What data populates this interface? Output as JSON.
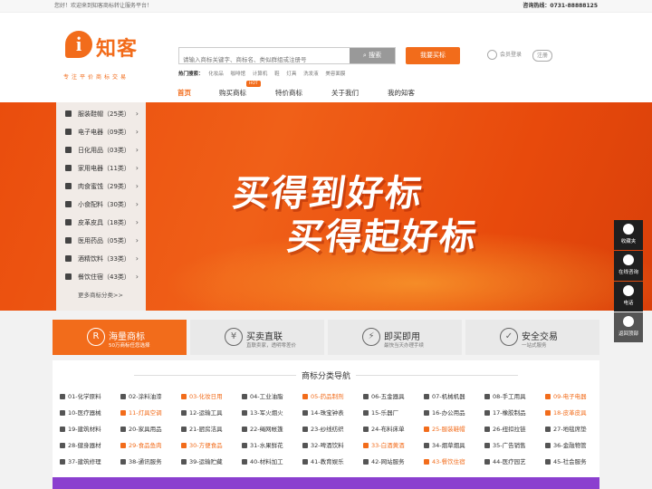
{
  "topbar": {
    "welcome": "您好！欢迎来到知客商标转让服务平台！",
    "hotline": "咨询热线：0731-88888125"
  },
  "logo": {
    "mark": "i",
    "name": "知客",
    "slogan": "专注平价商标交易"
  },
  "search": {
    "placeholder": "请输入商标关键字、商标名、类似群组或注册号",
    "button": "搜索",
    "hot_label": "热门搜索：",
    "hot_terms": [
      "化妆品",
      "咖啡馆",
      "计算机",
      "鞋",
      "灯具",
      "洗发液",
      "美容面膜"
    ]
  },
  "header": {
    "buy_button": "我要买标",
    "login": "会员登录",
    "register": "注册"
  },
  "nav": {
    "items": [
      "首页",
      "购买商标",
      "特价商标",
      "关于我们",
      "我的知客"
    ],
    "hot_badge": "HOT"
  },
  "banner": {
    "line1": "买得到好标",
    "line2": "买得起好标"
  },
  "categories": [
    {
      "label": "服装鞋帽（25类）"
    },
    {
      "label": "电子电器（09类）"
    },
    {
      "label": "日化用品（03类）"
    },
    {
      "label": "家用电器（11类）"
    },
    {
      "label": "肉食蜜饯（29类）"
    },
    {
      "label": "小食配料（30类）"
    },
    {
      "label": "皮革皮具（18类）"
    },
    {
      "label": "医用药品（05类）"
    },
    {
      "label": "酒精饮料（33类）"
    },
    {
      "label": "餐饮住宿（43类）"
    }
  ],
  "categories_more": "更多商标分类>>",
  "features": [
    {
      "icon": "R",
      "title": "海量商标",
      "sub": "50万商标任您选择"
    },
    {
      "icon": "¥",
      "title": "买卖直联",
      "sub": "直联卖家，透明零差价"
    },
    {
      "icon": "⚡",
      "title": "即买即用",
      "sub": "最快当天办理手续"
    },
    {
      "icon": "✓",
      "title": "安全交易",
      "sub": "一站式服务"
    }
  ],
  "guide": {
    "title": "商标分类导航",
    "items": [
      "01-化学原料",
      "02-涂料油漆",
      "03-化妆日用",
      "04-工业油脂",
      "05-药品制剂",
      "06-五金器具",
      "07-机械机器",
      "08-手工用具",
      "09-电子电器",
      "10-医疗器械",
      "11-灯具空调",
      "12-运输工具",
      "13-军火烟火",
      "14-珠宝钟表",
      "15-乐器厂",
      "16-办公用品",
      "17-橡胶制品",
      "18-皮革皮具",
      "19-建筑材料",
      "20-家具用品",
      "21-厨房洁具",
      "22-绳网帐篷",
      "23-纱线纺织",
      "24-布料床单",
      "25-服装鞋帽",
      "26-纽扣拉链",
      "27-地毯席垫",
      "28-健身器材",
      "29-食品鱼肉",
      "30-方便食品",
      "31-水果鲜花",
      "32-啤酒饮料",
      "33-白酒黄酒",
      "34-烟草烟具",
      "35-广告销售",
      "36-金融物管",
      "37-建筑修理",
      "38-通讯服务",
      "39-运输贮藏",
      "40-材料加工",
      "41-教育娱乐",
      "42-网站服务",
      "43-餐饮住宿",
      "44-医疗园艺",
      "45-社会服务"
    ],
    "highlighted": [
      2,
      4,
      8,
      10,
      17,
      24,
      28,
      29,
      32,
      42
    ]
  },
  "side": [
    {
      "label": "收藏夹"
    },
    {
      "label": "在线咨询"
    },
    {
      "label": "电话"
    },
    {
      "label": "返回顶部"
    }
  ],
  "colors": {
    "accent": "#f26c1b",
    "banner": "#ea4d0d"
  }
}
